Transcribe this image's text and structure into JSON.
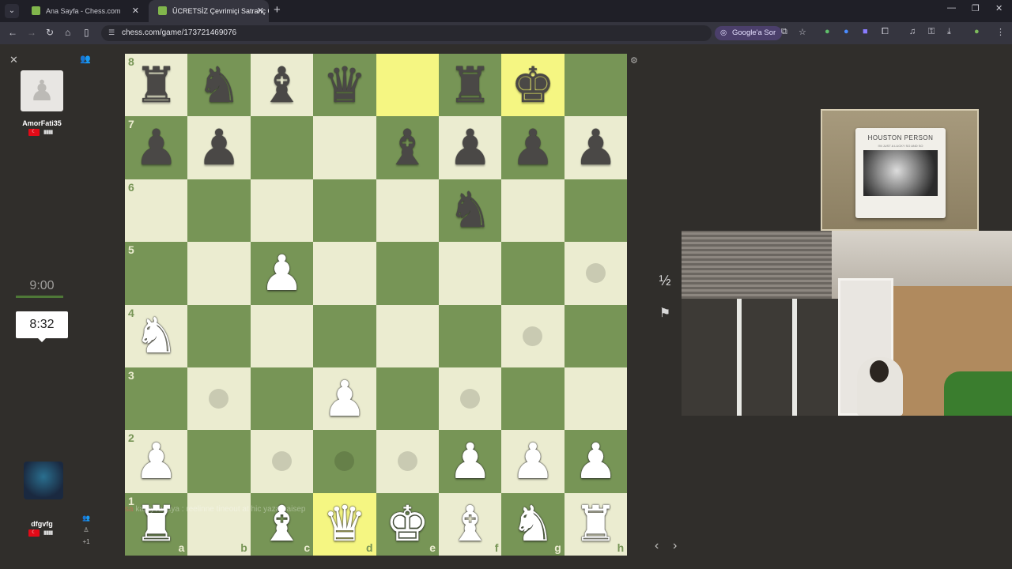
{
  "browser": {
    "tabs": [
      {
        "title": "Ana Sayfa - Chess.com",
        "active": false
      },
      {
        "title": "ÜCRETSİZ Çevrimiçi Satranç Oy",
        "active": true
      }
    ],
    "url": "chess.com/game/173721469076",
    "google_lens_label": "Google'a Sor"
  },
  "players": {
    "top": {
      "name": "AmorFati35",
      "country": "TR",
      "clock": "9:00"
    },
    "bottom": {
      "name": "dfgvfg",
      "country": "TR",
      "clock": "8:32",
      "extra": "+1"
    }
  },
  "chat": {
    "user": "sa",
    "message": "kantyvayaya : reelinne tineout at hic yazamaisep"
  },
  "controls": {
    "draw_label": "½",
    "resign_icon": "flag-icon"
  },
  "board": {
    "ranks": [
      "8",
      "7",
      "6",
      "5",
      "4",
      "3",
      "2",
      "1"
    ],
    "files": [
      "a",
      "b",
      "c",
      "d",
      "e",
      "f",
      "g",
      "h"
    ],
    "highlight": [
      "e8",
      "g8",
      "d1"
    ],
    "hints": [
      "h5",
      "g4",
      "b3",
      "f3",
      "c2",
      "d2",
      "e2"
    ],
    "pieces": {
      "a8": "br",
      "b8": "bn",
      "c8": "bb",
      "d8": "bq",
      "f8": "br",
      "g8": "bk",
      "a7": "bp",
      "b7": "bp",
      "e7": "bb",
      "f7": "bp",
      "g7": "bp",
      "h7": "bp",
      "f6": "bn",
      "c5": "wp",
      "a4": "wn",
      "d3": "wp",
      "a2": "wp",
      "f2": "wp",
      "g2": "wp",
      "h2": "wp",
      "a1": "wr",
      "c1": "wb",
      "d1": "wq",
      "e1": "wk",
      "f1": "wb",
      "g1": "wn",
      "h1": "wr"
    }
  },
  "album": {
    "title": "HOUSTON PERSON",
    "subtitle": "I'M JUST A LUCKY SO AND SO"
  }
}
